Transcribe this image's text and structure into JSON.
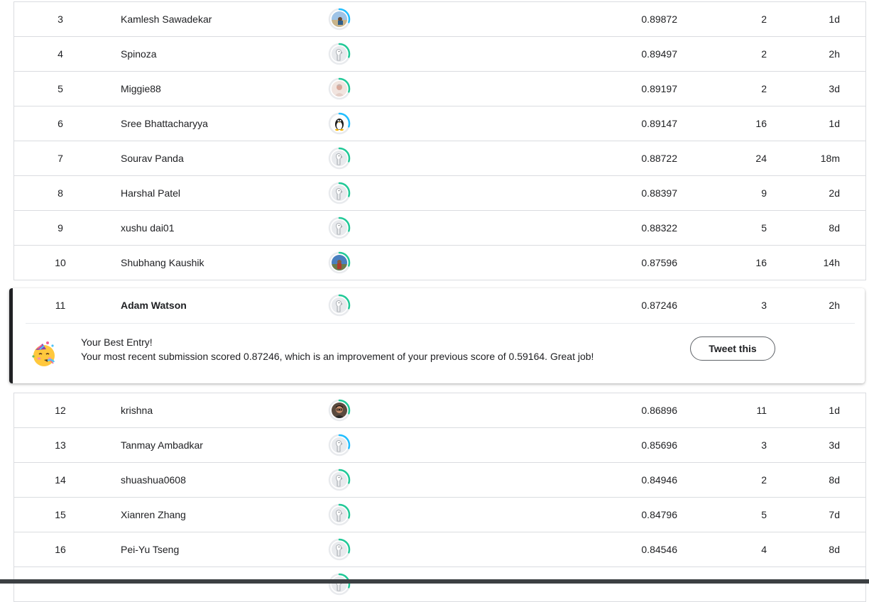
{
  "leaderboard_top": [
    {
      "rank": "3",
      "name": "Kamlesh Sawadekar",
      "score": "0.89872",
      "entries": "2",
      "last": "1d",
      "avatar": "photo-landscape",
      "ring": "#20BEFF"
    },
    {
      "rank": "4",
      "name": "Spinoza",
      "score": "0.89497",
      "entries": "2",
      "last": "2h",
      "avatar": "default-goose",
      "ring": "#20C997"
    },
    {
      "rank": "5",
      "name": "Miggie88",
      "score": "0.89197",
      "entries": "2",
      "last": "3d",
      "avatar": "photo-person-light",
      "ring": "#20C997"
    },
    {
      "rank": "6",
      "name": "Sree Bhattacharyya",
      "score": "0.89147",
      "entries": "16",
      "last": "1d",
      "avatar": "linux-penguin",
      "ring": "#20BEFF"
    },
    {
      "rank": "7",
      "name": "Sourav Panda",
      "score": "0.88722",
      "entries": "24",
      "last": "18m",
      "avatar": "default-goose",
      "ring": "#20C997"
    },
    {
      "rank": "8",
      "name": "Harshal Patel",
      "score": "0.88397",
      "entries": "9",
      "last": "2d",
      "avatar": "default-goose",
      "ring": "#20C997"
    },
    {
      "rank": "9",
      "name": "xushu dai01",
      "score": "0.88322",
      "entries": "5",
      "last": "8d",
      "avatar": "default-goose",
      "ring": "#20C997"
    },
    {
      "rank": "10",
      "name": "Shubhang Kaushik",
      "score": "0.87596",
      "entries": "16",
      "last": "14h",
      "avatar": "photo-outdoor",
      "ring": "#20C997"
    }
  ],
  "highlight": {
    "rank": "11",
    "name": "Adam Watson",
    "score": "0.87246",
    "entries": "3",
    "last": "2h",
    "avatar": "default-goose",
    "ring": "#20C997",
    "message_title": "Your Best Entry!",
    "message_body": "Your most recent submission scored 0.87246, which is an improvement of your previous score of 0.59164. Great job!",
    "tweet_label": "Tweet this",
    "emoji": "partying-face"
  },
  "leaderboard_bottom": [
    {
      "rank": "12",
      "name": "krishna",
      "score": "0.86896",
      "entries": "11",
      "last": "1d",
      "avatar": "photo-person-dark",
      "ring": "#20C997"
    },
    {
      "rank": "13",
      "name": "Tanmay Ambadkar",
      "score": "0.85696",
      "entries": "3",
      "last": "3d",
      "avatar": "default-goose",
      "ring": "#20BEFF"
    },
    {
      "rank": "14",
      "name": "shuashua0608",
      "score": "0.84946",
      "entries": "2",
      "last": "8d",
      "avatar": "default-goose",
      "ring": "#20C997"
    },
    {
      "rank": "15",
      "name": "Xianren Zhang",
      "score": "0.84796",
      "entries": "5",
      "last": "7d",
      "avatar": "default-goose",
      "ring": "#20C997"
    },
    {
      "rank": "16",
      "name": "Pei-Yu Tseng",
      "score": "0.84546",
      "entries": "4",
      "last": "8d",
      "avatar": "default-goose",
      "ring": "#20C997"
    },
    {
      "rank": "",
      "name": "",
      "score": "",
      "entries": "",
      "last": "",
      "avatar": "default-goose",
      "ring": "#20C997"
    }
  ]
}
